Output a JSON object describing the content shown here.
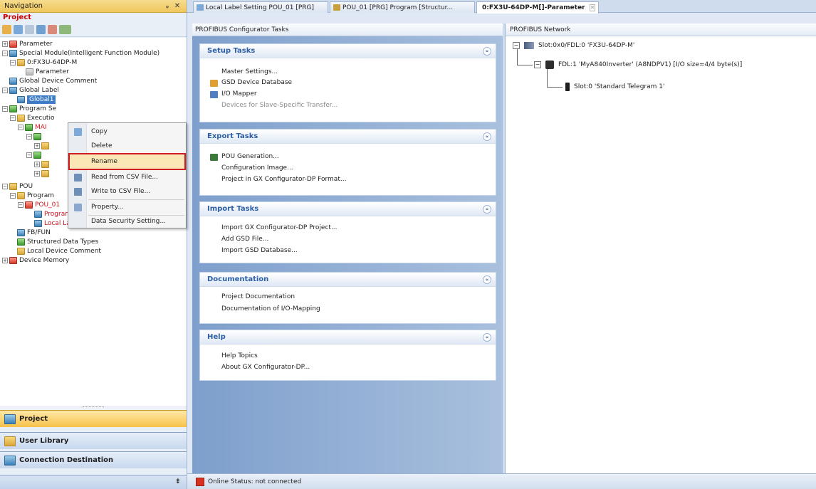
{
  "navigation": {
    "title": "Navigation",
    "pin": "ᵩ",
    "close": "✕",
    "project_label": "Project",
    "tree": [
      {
        "label": "Parameter"
      },
      {
        "label": "Special Module(Intelligent Function Module)"
      },
      {
        "label": "0:FX3U-64DP-M"
      },
      {
        "label": "Parameter"
      },
      {
        "label": "Global Device Comment"
      },
      {
        "label": "Global Label"
      },
      {
        "label": "Global1"
      },
      {
        "label": "Program Se"
      },
      {
        "label": "Executio"
      },
      {
        "label": "MAI"
      },
      {
        "label": "POU"
      },
      {
        "label": "Program"
      },
      {
        "label": "POU_01"
      },
      {
        "label": "Program"
      },
      {
        "label": "Local Label"
      },
      {
        "label": "FB/FUN"
      },
      {
        "label": "Structured Data Types"
      },
      {
        "label": "Local Device Comment"
      },
      {
        "label": "Device Memory"
      }
    ],
    "bottom_buttons": [
      {
        "label": "Project"
      },
      {
        "label": "User Library"
      },
      {
        "label": "Connection Destination"
      }
    ],
    "footer_glyph": "⇟"
  },
  "context_menu": {
    "items": [
      {
        "label": "Copy"
      },
      {
        "label": "Delete"
      },
      {
        "label": "Rename"
      },
      {
        "label": "Read from CSV File..."
      },
      {
        "label": "Write to CSV File..."
      },
      {
        "label": "Property..."
      },
      {
        "label": "Data Security Setting..."
      }
    ]
  },
  "tabs": [
    {
      "label": "Local Label Setting POU_01 [PRG]"
    },
    {
      "label": "POU_01 [PRG] Program [Structur..."
    },
    {
      "label": "0:FX3U-64DP-M[]-Parameter"
    }
  ],
  "tasks": {
    "title": "PROFIBUS Configurator Tasks",
    "groups": [
      {
        "title": "Setup Tasks",
        "items": [
          "Master Settings...",
          "GSD Device Database",
          "I/O Mapper",
          "Devices for Slave-Specific Transfer..."
        ]
      },
      {
        "title": "Export Tasks",
        "items": [
          "POU Generation...",
          "Configuration Image...",
          "Project in GX Configurator-DP Format..."
        ]
      },
      {
        "title": "Import Tasks",
        "items": [
          "Import GX Configurator-DP Project...",
          "Add GSD File...",
          "Import GSD Database..."
        ]
      },
      {
        "title": "Documentation",
        "items": [
          "Project Documentation",
          "Documentation of I/O-Mapping"
        ]
      },
      {
        "title": "Help",
        "items": [
          "Help Topics",
          "About GX Configurator-DP..."
        ]
      }
    ],
    "chevron": "«"
  },
  "network": {
    "title": "PROFIBUS Network",
    "nodes": [
      {
        "label": "Slot:0x0/FDL:0 'FX3U-64DP-M'"
      },
      {
        "label": "FDL:1 'MyA840Inverter' (A8NDPV1) [I/O size=4/4 byte(s)]"
      },
      {
        "label": "Slot:0 'Standard Telegram 1'"
      }
    ],
    "collapse_glyph": "−"
  },
  "status": {
    "text": "Online Status: not connected"
  },
  "colors": {
    "accent_red": "#d11d22",
    "selection_blue": "#3f7cc7",
    "task_header_blue": "#2d5fa4",
    "active_nav": "#f7c24a"
  }
}
